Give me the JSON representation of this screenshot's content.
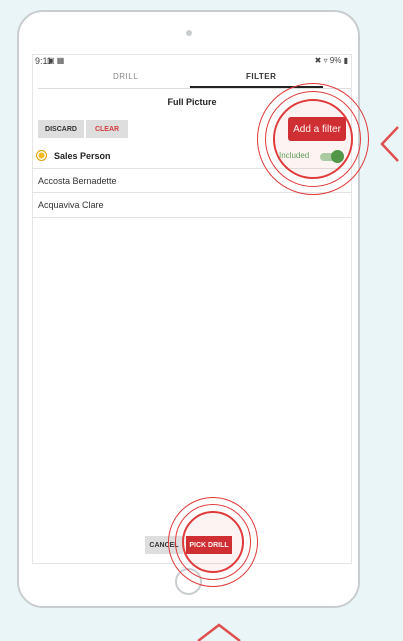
{
  "status_bar": {
    "time": "9:11",
    "left_icons": "▣ ▦",
    "right_icons": "✖ ▿ 9% ▮"
  },
  "tabs": [
    {
      "label": "DRILL",
      "active": false
    },
    {
      "label": "FILTER",
      "active": true
    }
  ],
  "page_title": "Full Picture",
  "actions": {
    "discard_label": "DISCARD",
    "clear_label": "CLEAR",
    "add_filter_label": "Add a filter"
  },
  "filter": {
    "name": "Sales Person",
    "status": "Included",
    "enabled": true,
    "icon": "filter-dot-icon"
  },
  "items": [
    {
      "label": "Accosta Bernadette"
    },
    {
      "label": "Acquaviva Clare"
    }
  ],
  "footer": {
    "cancel_label": "CANCEL",
    "pick_label": "PICK DRILL"
  },
  "colors": {
    "accent": "#cf2f33",
    "highlight": "#e03a3a",
    "toggle_on": "#4a9d4a",
    "background": "#e9f5f6"
  }
}
